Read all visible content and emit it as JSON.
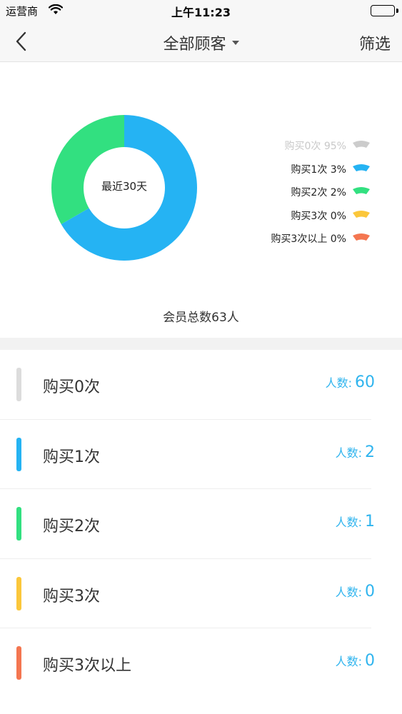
{
  "status_bar": {
    "carrier": "运营商",
    "time": "上午11:23"
  },
  "nav": {
    "title": "全部顾客",
    "filter_label": "筛选"
  },
  "chart_data": {
    "type": "pie",
    "center_label": "最近30天",
    "categories": [
      "购买0次",
      "购买1次",
      "购买2次",
      "购买3次",
      "购买3次以上"
    ],
    "values": [
      0,
      2,
      1,
      0,
      0
    ],
    "legend_labels": [
      "购买0次 95%",
      "购买1次 3%",
      "购买2次 2%",
      "购买3次 0%",
      "购买3次以上 0%"
    ],
    "colors": [
      "#cccccc",
      "#25b3f3",
      "#32e080",
      "#fbc73b",
      "#f47650"
    ],
    "legend_position": "right"
  },
  "summary": {
    "total_members": "会员总数63人"
  },
  "list": {
    "items": [
      {
        "label": "购买0次",
        "count_label": "人数:",
        "count": "60",
        "color": "#dcdcdc"
      },
      {
        "label": "购买1次",
        "count_label": "人数:",
        "count": "2",
        "color": "#25b3f3"
      },
      {
        "label": "购买2次",
        "count_label": "人数:",
        "count": "1",
        "color": "#32e080"
      },
      {
        "label": "购买3次",
        "count_label": "人数:",
        "count": "0",
        "color": "#fbc73b"
      },
      {
        "label": "购买3次以上",
        "count_label": "人数:",
        "count": "0",
        "color": "#f47650"
      }
    ]
  }
}
